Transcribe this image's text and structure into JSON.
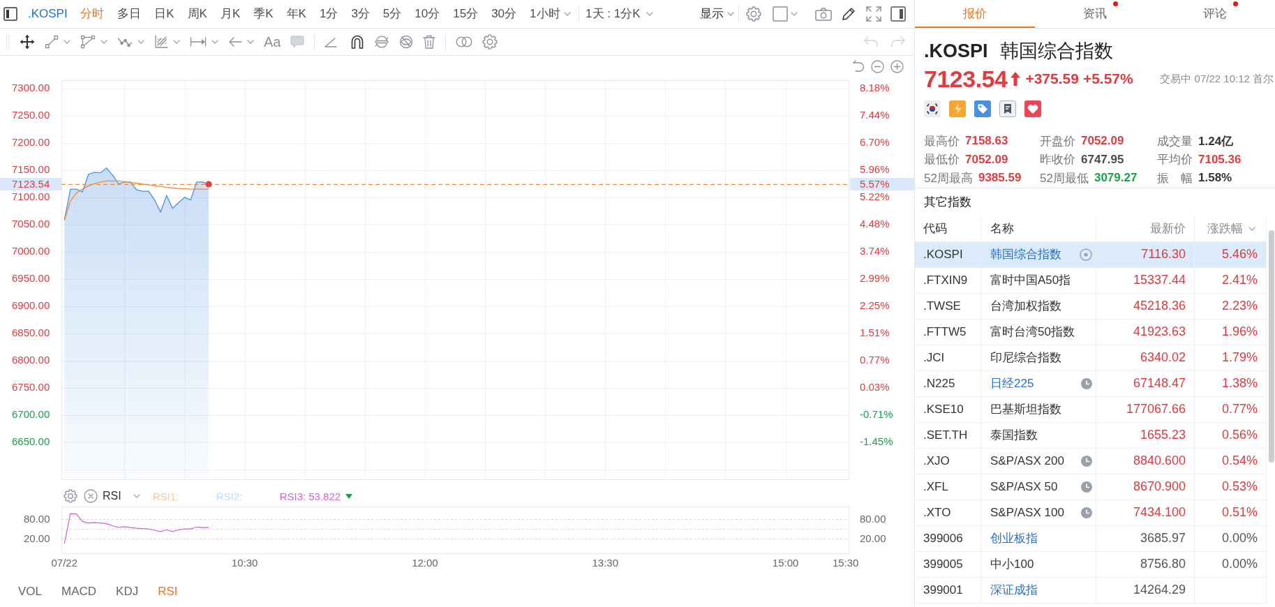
{
  "toolbar": {
    "symbol": ".KOSPI",
    "periods": [
      {
        "label": "分时",
        "selected": true,
        "dropdown": false
      },
      {
        "label": "多日",
        "selected": false,
        "dropdown": false
      },
      {
        "label": "日K",
        "selected": false,
        "dropdown": false
      },
      {
        "label": "周K",
        "selected": false,
        "dropdown": false
      },
      {
        "label": "月K",
        "selected": false,
        "dropdown": false
      },
      {
        "label": "季K",
        "selected": false,
        "dropdown": false
      },
      {
        "label": "年K",
        "selected": false,
        "dropdown": false
      },
      {
        "label": "1分",
        "selected": false,
        "dropdown": false
      },
      {
        "label": "3分",
        "selected": false,
        "dropdown": false
      },
      {
        "label": "5分",
        "selected": false,
        "dropdown": false
      },
      {
        "label": "10分",
        "selected": false,
        "dropdown": false
      },
      {
        "label": "15分",
        "selected": false,
        "dropdown": false
      },
      {
        "label": "30分",
        "selected": false,
        "dropdown": false
      },
      {
        "label": "1小时",
        "selected": false,
        "dropdown": true
      }
    ],
    "range": "1天 : 1分K",
    "display": "显示"
  },
  "drawing_toolbar": {
    "text_tool": "Aa",
    "history": [
      {
        "kind": "undo",
        "disabled": true
      },
      {
        "kind": "redo",
        "disabled": true
      }
    ]
  },
  "price_chart": {
    "chart_data": {
      "type": "area",
      "grid": true,
      "categories": [
        null,
        null,
        null,
        null,
        null,
        null,
        null,
        null,
        null,
        null,
        null,
        null,
        null,
        null,
        null,
        null,
        null,
        null,
        null,
        null,
        null,
        null,
        null,
        null,
        null,
        null,
        null,
        null,
        null,
        null,
        null,
        null,
        null,
        null,
        null,
        null,
        null,
        null,
        null,
        null,
        null,
        null,
        null,
        null,
        null,
        null,
        null,
        null,
        null,
        null,
        null,
        null,
        null,
        null,
        null,
        null,
        null,
        null,
        null,
        null,
        null,
        null,
        null,
        null,
        null,
        null,
        null,
        null,
        null,
        null,
        null,
        null,
        null,
        null,
        null,
        null,
        null,
        null,
        null,
        null,
        null,
        null,
        null,
        null,
        null,
        null,
        null,
        null,
        null,
        null,
        null,
        null,
        null,
        null,
        null,
        null,
        null,
        null,
        null,
        null,
        null,
        null,
        null,
        null,
        null,
        null,
        null,
        null,
        null,
        null,
        null,
        null,
        null,
        null,
        null,
        null,
        null,
        null,
        null,
        null,
        null,
        null,
        null,
        null,
        null,
        null,
        null,
        null,
        null,
        null,
        null
      ],
      "series": [
        {
          "color": "#4a8fe0",
          "values": [
            7058,
            7115,
            7115,
            7110,
            7142,
            7146,
            7145,
            7154,
            7141,
            7125,
            7128,
            7128,
            7114,
            7111,
            7111,
            7095,
            7073,
            7103,
            7080,
            7090,
            7100,
            7095,
            7128,
            7128,
            7124,
            null,
            null,
            null,
            null,
            null,
            null,
            null,
            null,
            null,
            null,
            null,
            null,
            null,
            null,
            null,
            null,
            null,
            null,
            null,
            null,
            null,
            null,
            null,
            null,
            null,
            null,
            null,
            null,
            null,
            null,
            null,
            null,
            null,
            null,
            null,
            null,
            null,
            null,
            null,
            null,
            null,
            null,
            null,
            null,
            null,
            null,
            null,
            null,
            null,
            null,
            null,
            null,
            null,
            null,
            null,
            null,
            null,
            null,
            null,
            null,
            null,
            null,
            null,
            null,
            null,
            null,
            null,
            null,
            null,
            null,
            null,
            null,
            null,
            null,
            null,
            null,
            null,
            null,
            null,
            null,
            null,
            null,
            null,
            null,
            null,
            null,
            null,
            null,
            null,
            null,
            null,
            null,
            null,
            null,
            null,
            null,
            null,
            null,
            null,
            null,
            null,
            null,
            null,
            null,
            null,
            null
          ]
        },
        {
          "type": "line",
          "color": "#ee8a3c",
          "values": [
            7058,
            7093,
            7108,
            7115,
            7121,
            7125,
            7128,
            7130,
            7130,
            7130,
            7129,
            7127,
            7126,
            7124,
            7123,
            7121,
            7120,
            7118,
            7117,
            7116,
            7116,
            7115,
            7115,
            7115,
            7115,
            null,
            null,
            null,
            null,
            null,
            null,
            null,
            null,
            null,
            null,
            null,
            null,
            null,
            null,
            null,
            null,
            null,
            null,
            null,
            null,
            null,
            null,
            null,
            null,
            null,
            null,
            null,
            null,
            null,
            null,
            null,
            null,
            null,
            null,
            null,
            null,
            null,
            null,
            null,
            null,
            null,
            null,
            null,
            null,
            null,
            null,
            null,
            null,
            null,
            null,
            null,
            null,
            null,
            null,
            null,
            null,
            null,
            null,
            null,
            null,
            null,
            null,
            null,
            null,
            null,
            null,
            null,
            null,
            null,
            null,
            null,
            null,
            null,
            null,
            null,
            null,
            null,
            null,
            null,
            null,
            null,
            null,
            null,
            null,
            null,
            null,
            null,
            null,
            null,
            null,
            null,
            null,
            null,
            null,
            null,
            null,
            null,
            null,
            null,
            null,
            null,
            null,
            null,
            null,
            null,
            null
          ]
        }
      ],
      "ylim": [
        6582,
        7315
      ],
      "yticks": [
        {
          "value": 7300,
          "label": "7300.00"
        },
        {
          "value": 7250,
          "label": "7250.00"
        },
        {
          "value": 7200,
          "label": "7200.00"
        },
        {
          "value": 7150,
          "label": "7150.00"
        },
        {
          "value": 7100,
          "label": "7100.00"
        },
        {
          "value": 7050,
          "label": "7050.00"
        },
        {
          "value": 7000,
          "label": "7000.00"
        },
        {
          "value": 6950,
          "label": "6950.00"
        },
        {
          "value": 6900,
          "label": "6900.00"
        },
        {
          "value": 6850,
          "label": "6850.00"
        },
        {
          "value": 6800,
          "label": "6800.00"
        },
        {
          "value": 6750,
          "label": "6750.00"
        },
        {
          "value": 6700,
          "label": "6700.00"
        },
        {
          "value": 6650,
          "label": "6650.00"
        }
      ],
      "ref_lines": [
        {
          "axis": "y",
          "value": 7123.54,
          "label": "7123.54"
        }
      ]
    },
    "percent_axis": [
      {
        "label": "8.18%",
        "color": "#e23a3f"
      },
      {
        "label": "7.44%",
        "color": "#e23a3f"
      },
      {
        "label": "6.70%",
        "color": "#e23a3f"
      },
      {
        "label": "5.96%",
        "color": "#e23a3f"
      },
      {
        "label": "5.22%",
        "color": "#e23a3f"
      },
      {
        "label": "4.48%",
        "color": "#e23a3f"
      },
      {
        "label": "3.74%",
        "color": "#e23a3f"
      },
      {
        "label": "2.99%",
        "color": "#e23a3f"
      },
      {
        "label": "2.25%",
        "color": "#e23a3f"
      },
      {
        "label": "1.51%",
        "color": "#e23a3f"
      },
      {
        "label": "0.77%",
        "color": "#e23a3f"
      },
      {
        "label": "0.03%",
        "color": "#e23a3f"
      },
      {
        "label": "-0.71%",
        "color": "#17a34a"
      },
      {
        "label": "-1.45%",
        "color": "#17a34a"
      }
    ],
    "last_percent": "5.57%"
  },
  "rsi_panel": {
    "indicator": "RSI",
    "legend": [
      {
        "label": "RSI1:",
        "color": "#f7c8a0",
        "falling": false
      },
      {
        "label": "RSI2:",
        "color": "#bddcf3",
        "falling": false
      },
      {
        "label": "RSI3:",
        "value": "53.822",
        "color": "#d65fd2",
        "falling": true
      }
    ],
    "chart_data": {
      "type": "line",
      "grid": true,
      "categories": [
        "07/22",
        null,
        null,
        null,
        null,
        null,
        null,
        null,
        null,
        null,
        null,
        null,
        null,
        null,
        null,
        null,
        null,
        null,
        null,
        null,
        null,
        null,
        null,
        null,
        null,
        null,
        null,
        null,
        null,
        null,
        "10:30",
        null,
        null,
        null,
        null,
        null,
        null,
        null,
        null,
        null,
        null,
        null,
        null,
        null,
        null,
        null,
        null,
        null,
        null,
        null,
        null,
        null,
        null,
        null,
        null,
        null,
        null,
        null,
        null,
        null,
        "12:00",
        null,
        null,
        null,
        null,
        null,
        null,
        null,
        null,
        null,
        null,
        null,
        null,
        null,
        null,
        null,
        null,
        null,
        null,
        null,
        null,
        null,
        null,
        null,
        null,
        null,
        null,
        null,
        null,
        null,
        "13:30",
        null,
        null,
        null,
        null,
        null,
        null,
        null,
        null,
        null,
        null,
        null,
        null,
        null,
        null,
        null,
        null,
        null,
        null,
        null,
        null,
        null,
        null,
        null,
        null,
        null,
        null,
        null,
        null,
        null,
        "15:00",
        null,
        null,
        null,
        null,
        null,
        null,
        null,
        null,
        null,
        "15:30"
      ],
      "series": [
        {
          "color": "#d65fd2",
          "values": [
            5,
            97,
            96,
            73,
            68,
            70,
            68,
            66,
            60,
            55,
            57,
            54,
            52,
            51,
            50,
            46,
            42,
            47,
            42,
            47,
            50,
            50,
            56,
            54,
            54,
            null,
            null,
            null,
            null,
            null,
            null,
            null,
            null,
            null,
            null,
            null,
            null,
            null,
            null,
            null,
            null,
            null,
            null,
            null,
            null,
            null,
            null,
            null,
            null,
            null,
            null,
            null,
            null,
            null,
            null,
            null,
            null,
            null,
            null,
            null,
            null,
            null,
            null,
            null,
            null,
            null,
            null,
            null,
            null,
            null,
            null,
            null,
            null,
            null,
            null,
            null,
            null,
            null,
            null,
            null,
            null,
            null,
            null,
            null,
            null,
            null,
            null,
            null,
            null,
            null,
            null,
            null,
            null,
            null,
            null,
            null,
            null,
            null,
            null,
            null,
            null,
            null,
            null,
            null,
            null,
            null,
            null,
            null,
            null,
            null,
            null,
            null,
            null,
            null,
            null,
            null,
            null,
            null,
            null,
            null,
            null,
            null,
            null,
            null,
            null,
            null,
            null,
            null,
            null,
            null,
            null
          ]
        }
      ],
      "ylim": [
        -25,
        119
      ],
      "yticks": [
        {
          "value": 80,
          "label": "80.00"
        },
        {
          "value": 20,
          "label": "20.00"
        }
      ]
    },
    "right_axis_labels": [
      "80.00",
      "20.00"
    ]
  },
  "indicator_tabs": [
    {
      "label": "VOL",
      "selected": false
    },
    {
      "label": "MACD",
      "selected": false
    },
    {
      "label": "KDJ",
      "selected": false
    },
    {
      "label": "RSI",
      "selected": true
    }
  ],
  "quote": {
    "tabs": [
      {
        "label": "报价",
        "selected": true,
        "unread": false
      },
      {
        "label": "资讯",
        "selected": false,
        "unread": true
      },
      {
        "label": "评论",
        "selected": false,
        "unread": true
      }
    ],
    "symbol": ".KOSPI",
    "name": "韩国综合指数",
    "price": "7123.54",
    "rising": true,
    "change": "+375.59",
    "change_percent": "+5.57%",
    "status": "交易中 07/22 10:12 首尔",
    "stats": [
      {
        "label": "最高价",
        "value": "7158.63",
        "color": "#e23a3f"
      },
      {
        "label": "开盘价",
        "value": "7052.09",
        "color": "#e23a3f"
      },
      {
        "label": "成交量",
        "value": "1.24亿",
        "color": "#333333"
      },
      {
        "label": "最低价",
        "value": "7052.09",
        "color": "#e23a3f"
      },
      {
        "label": "昨收价",
        "value": "6747.95",
        "color": "#4a4a4a"
      },
      {
        "label": "平均价",
        "value": "7105.36",
        "color": "#e23a3f"
      },
      {
        "label": "52周最高",
        "value": "9385.59",
        "color": "#e23a3f"
      },
      {
        "label": "52周最低",
        "value": "3079.27",
        "color": "#17a34a"
      },
      {
        "label": "振　幅",
        "value": "1.58%",
        "color": "#333333"
      }
    ]
  },
  "other_indices": {
    "title": "其它指数",
    "columns": [
      {
        "label": "代码",
        "sorted": false
      },
      {
        "label": "名称",
        "sorted": false
      },
      {
        "label": "最新价",
        "sorted": false
      },
      {
        "label": "涨跌幅",
        "sorted": true
      }
    ],
    "rows": [
      {
        "code": ".KOSPI",
        "name": "韩国综合指数",
        "price": "7116.30",
        "change": "5.46%",
        "color": "#e0383e",
        "linked": true,
        "current": true,
        "delayed": false,
        "selected": true
      },
      {
        "code": ".FTXIN9",
        "name": "富时中国A50指",
        "price": "15337.44",
        "change": "2.41%",
        "color": "#e0383e",
        "linked": false,
        "current": false,
        "delayed": false,
        "selected": false
      },
      {
        "code": ".TWSE",
        "name": "台湾加权指数",
        "price": "45218.36",
        "change": "2.23%",
        "color": "#e0383e",
        "linked": false,
        "current": false,
        "delayed": false,
        "selected": false
      },
      {
        "code": ".FTTW5",
        "name": "富时台湾50指数",
        "price": "41923.63",
        "change": "1.96%",
        "color": "#e0383e",
        "linked": false,
        "current": false,
        "delayed": false,
        "selected": false
      },
      {
        "code": ".JCI",
        "name": "印尼综合指数",
        "price": "6340.02",
        "change": "1.79%",
        "color": "#e0383e",
        "linked": false,
        "current": false,
        "delayed": false,
        "selected": false
      },
      {
        "code": ".N225",
        "name": "日经225",
        "price": "67148.47",
        "change": "1.38%",
        "color": "#e0383e",
        "linked": true,
        "current": false,
        "delayed": true,
        "selected": false
      },
      {
        "code": ".KSE10",
        "name": "巴基斯坦指数",
        "price": "177067.66",
        "change": "0.77%",
        "color": "#e0383e",
        "linked": false,
        "current": false,
        "delayed": false,
        "selected": false
      },
      {
        "code": ".SET.TH",
        "name": "泰国指数",
        "price": "1655.23",
        "change": "0.56%",
        "color": "#e0383e",
        "linked": false,
        "current": false,
        "delayed": false,
        "selected": false
      },
      {
        "code": ".XJO",
        "name": "S&P/ASX 200",
        "price": "8840.600",
        "change": "0.54%",
        "color": "#e0383e",
        "linked": false,
        "current": false,
        "delayed": true,
        "selected": false
      },
      {
        "code": ".XFL",
        "name": "S&P/ASX 50",
        "price": "8670.900",
        "change": "0.53%",
        "color": "#e0383e",
        "linked": false,
        "current": false,
        "delayed": true,
        "selected": false
      },
      {
        "code": ".XTO",
        "name": "S&P/ASX 100",
        "price": "7434.100",
        "change": "0.51%",
        "color": "#e0383e",
        "linked": false,
        "current": false,
        "delayed": true,
        "selected": false
      },
      {
        "code": "399006",
        "name": "创业板指",
        "price": "3685.97",
        "change": "0.00%",
        "color": "#555555",
        "linked": true,
        "current": false,
        "delayed": false,
        "selected": false
      },
      {
        "code": "399005",
        "name": "中小100",
        "price": "8756.80",
        "change": "0.00%",
        "color": "#555555",
        "linked": false,
        "current": false,
        "delayed": false,
        "selected": false
      },
      {
        "code": "399001",
        "name": "深证成指",
        "price": "14264.29",
        "color": "#555555",
        "linked": true,
        "current": false,
        "delayed": false,
        "selected": false
      }
    ]
  }
}
